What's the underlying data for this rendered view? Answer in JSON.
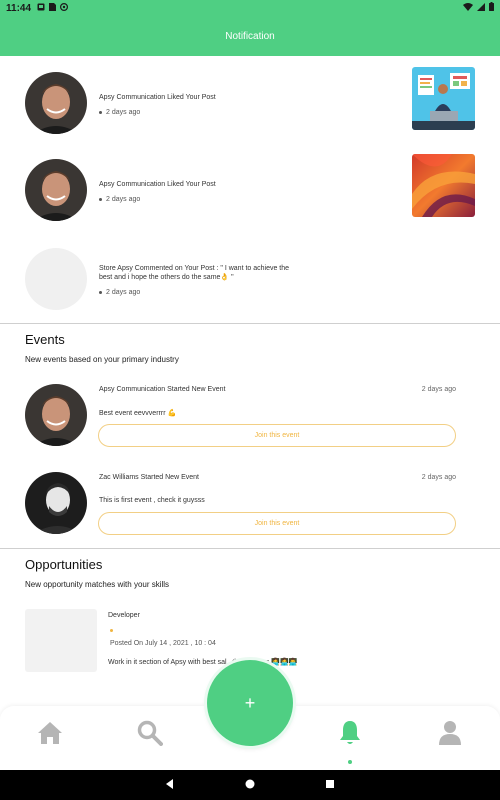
{
  "status_bar": {
    "time": "11:44"
  },
  "app_bar": {
    "title": "Notification"
  },
  "notifications": [
    {
      "text": "Apsy Communication Liked Your Post",
      "time": "2 days ago"
    },
    {
      "text": "Apsy Communication Liked Your Post",
      "time": "2 days ago"
    },
    {
      "text": "Store Apsy Commented on Your Post : \" I want to achieve the best and i hope the others do the same👌 \"",
      "time": "2 days ago"
    }
  ],
  "events": {
    "title": "Events",
    "subtitle": "New events based on your primary industry",
    "items": [
      {
        "title": "Apsy Communication Started New Event",
        "time": "2 days ago",
        "description": "Best event eevvverrrr 💪",
        "button": "Join this event"
      },
      {
        "title": "Zac Williams Started New Event",
        "time": "2 days ago",
        "description": "This is first event , check it guysss",
        "button": "Join this event"
      }
    ]
  },
  "opportunities": {
    "title": "Opportunities",
    "subtitle": "New opportunity matches with your skills",
    "items": [
      {
        "title": "Developer",
        "posted": "Posted On July 14 , 2021 , 10 : 04",
        "description": "Work in it section of Apsy with best sal...this position 👩‍💻👩‍💻👨‍💻"
      }
    ]
  },
  "fab": {
    "label": "+"
  },
  "colors": {
    "accent": "#4fcf83",
    "join": "#f0b541"
  },
  "nav": {
    "active": "notifications"
  }
}
